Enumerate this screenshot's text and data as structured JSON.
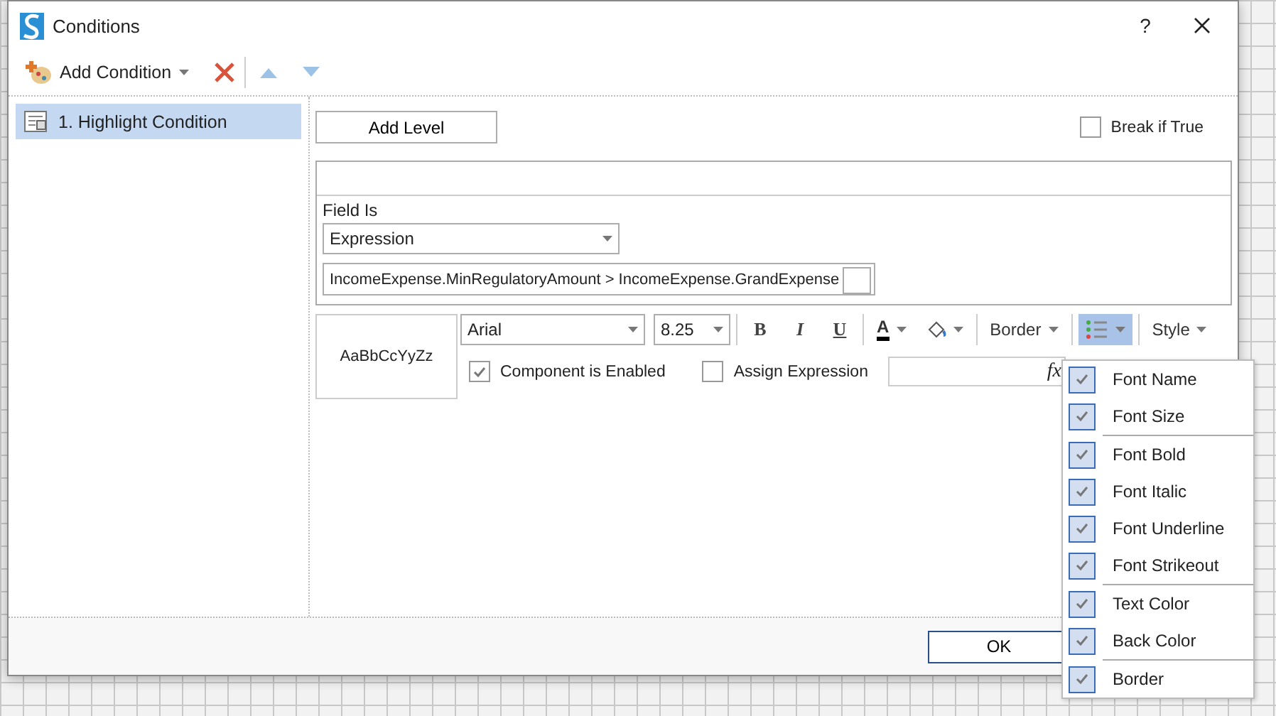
{
  "window": {
    "title": "Conditions",
    "help": "?"
  },
  "toolbar": {
    "add_condition": "Add Condition"
  },
  "conditions": [
    {
      "label": "1. Highlight Condition",
      "selected": true
    }
  ],
  "add_level": "Add Level",
  "break_if_true": {
    "label": "Break if True",
    "checked": false
  },
  "field_is": {
    "label": "Field Is",
    "type": "Expression",
    "expression": "IncomeExpense.MinRegulatoryAmount > IncomeExpense.GrandExpense"
  },
  "style": {
    "preview": "AaBbCcYyZz",
    "font": "Arial",
    "size": "8.25",
    "bold": "B",
    "italic": "I",
    "underline": "U",
    "text_color": "A",
    "border": "Border",
    "style": "Style"
  },
  "component_enabled": {
    "label": "Component is Enabled",
    "checked": true
  },
  "assign_expression": {
    "label": "Assign Expression",
    "checked": false,
    "fx": "fx"
  },
  "ok": "OK",
  "menu": {
    "groups": [
      [
        {
          "label": "Font Name",
          "checked": true
        },
        {
          "label": "Font Size",
          "checked": true
        }
      ],
      [
        {
          "label": "Font Bold",
          "checked": true
        },
        {
          "label": "Font Italic",
          "checked": true
        },
        {
          "label": "Font Underline",
          "checked": true
        },
        {
          "label": "Font Strikeout",
          "checked": true
        }
      ],
      [
        {
          "label": "Text Color",
          "checked": true
        },
        {
          "label": "Back Color",
          "checked": true
        }
      ],
      [
        {
          "label": "Border",
          "checked": true
        }
      ]
    ]
  }
}
